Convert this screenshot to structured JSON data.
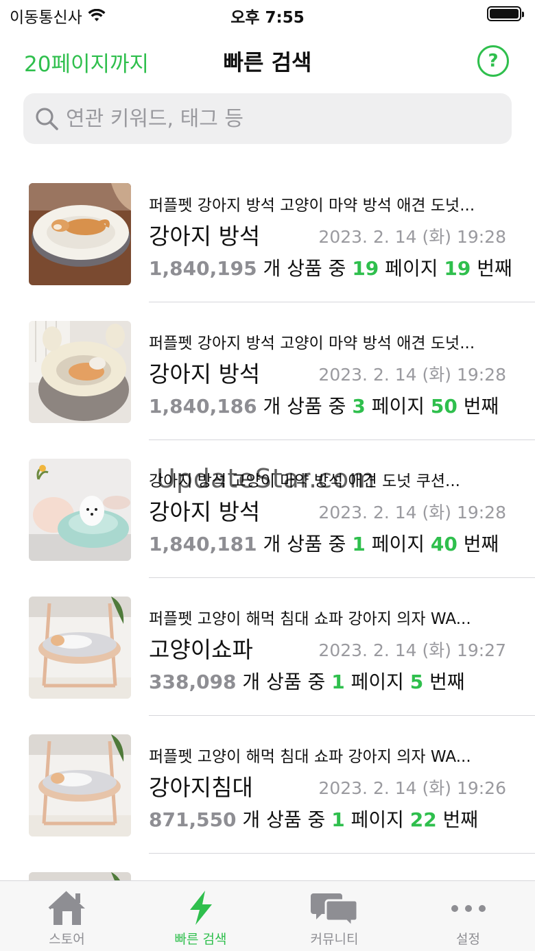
{
  "status_bar": {
    "carrier": "이동통신사",
    "time": "오후 7:55"
  },
  "nav": {
    "left_label": "20페이지까지",
    "title": "빠른 검색",
    "help_label": "?"
  },
  "search": {
    "placeholder": "연관 키워드, 태그 등",
    "value": ""
  },
  "items": [
    {
      "title": "퍼플펫 강아지 방석 고양이 마약 방석 애견 도넛...",
      "keyword": "강아지 방석",
      "date": "2023. 2. 14 (화) 19:28",
      "count": "1,840,195",
      "mid1": " 개 상품 중 ",
      "page": "19",
      "mid2": " 페이지 ",
      "rank": "19",
      "suffix": " 번째"
    },
    {
      "title": "퍼플펫 강아지 방석 고양이 마약 방석 애견 도넛...",
      "keyword": "강아지 방석",
      "date": "2023. 2. 14 (화) 19:28",
      "count": "1,840,186",
      "mid1": " 개 상품 중 ",
      "page": "3",
      "mid2": " 페이지 ",
      "rank": "50",
      "suffix": " 번째"
    },
    {
      "title": "강아지 방석 고양이 마약 방석 애견 도넛 쿠션...",
      "keyword": "강아지 방석",
      "date": "2023. 2. 14 (화) 19:28",
      "count": "1,840,181",
      "mid1": " 개 상품 중 ",
      "page": "1",
      "mid2": " 페이지 ",
      "rank": "40",
      "suffix": " 번째"
    },
    {
      "title": "퍼플펫 고양이 해먹 침대 쇼파 강아지 의자 WA...",
      "keyword": "고양이쇼파",
      "date": "2023. 2. 14 (화) 19:27",
      "count": "338,098",
      "mid1": " 개 상품 중 ",
      "page": "1",
      "mid2": " 페이지 ",
      "rank": "5",
      "suffix": " 번째"
    },
    {
      "title": "퍼플펫 고양이 해먹 침대 쇼파 강아지 의자 WA...",
      "keyword": "강아지침대",
      "date": "2023. 2. 14 (화) 19:26",
      "count": "871,550",
      "mid1": " 개 상품 중 ",
      "page": "1",
      "mid2": " 페이지 ",
      "rank": "22",
      "suffix": " 번째"
    }
  ],
  "watermark": "UpdateStar.com",
  "tabs": [
    {
      "label": "스토어",
      "icon": "house-icon"
    },
    {
      "label": "빠른 검색",
      "icon": "lightning-icon"
    },
    {
      "label": "커뮤니티",
      "icon": "chat-bubbles-icon"
    },
    {
      "label": "설정",
      "icon": "more-dots-icon"
    }
  ],
  "colors": {
    "accent": "#2fbf4d",
    "secondary_text": "#8e8e93",
    "search_bg": "#efeff0"
  }
}
